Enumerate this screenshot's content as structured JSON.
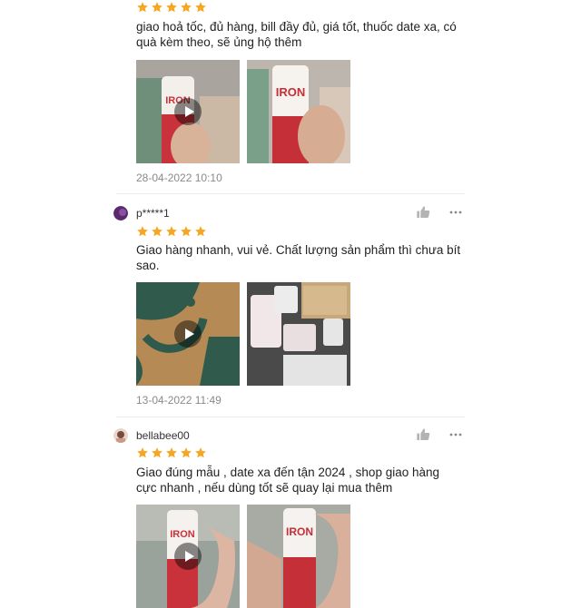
{
  "colors": {
    "star": "#f6a623",
    "date": "#8a8a8a",
    "divider": "#ececec",
    "icon": "#b3b3b3"
  },
  "icons": {
    "like": "thumbs-up-icon",
    "more": "more-options-icon",
    "play": "play-icon",
    "star": "star-icon"
  },
  "reviews": [
    {
      "username": "",
      "rating": 5,
      "comment": "giao hoả tốc, đủ hàng, bill đầy đủ, giá tốt, thuốc date xa, có quà kèm theo, sẽ ủng hộ thêm",
      "media": [
        "video",
        "image"
      ],
      "media_text": [
        "IRON",
        "IRON"
      ],
      "date": "28-04-2022 10:10"
    },
    {
      "username": "p*****1",
      "rating": 5,
      "comment": "Giao hàng nhanh, vui vẻ. Chất lượng sản phẩm thì chưa bít sao.",
      "media": [
        "video",
        "image"
      ],
      "date": "13-04-2022 11:49"
    },
    {
      "username": "bellabee00",
      "rating": 5,
      "comment": "Giao đúng mẫu , date xa đến tận 2024 , shop giao hàng cực nhanh , nếu dùng tốt sẽ quay lại mua thêm",
      "media": [
        "video",
        "image"
      ],
      "media_text": [
        "IRON",
        "IRON"
      ]
    }
  ]
}
